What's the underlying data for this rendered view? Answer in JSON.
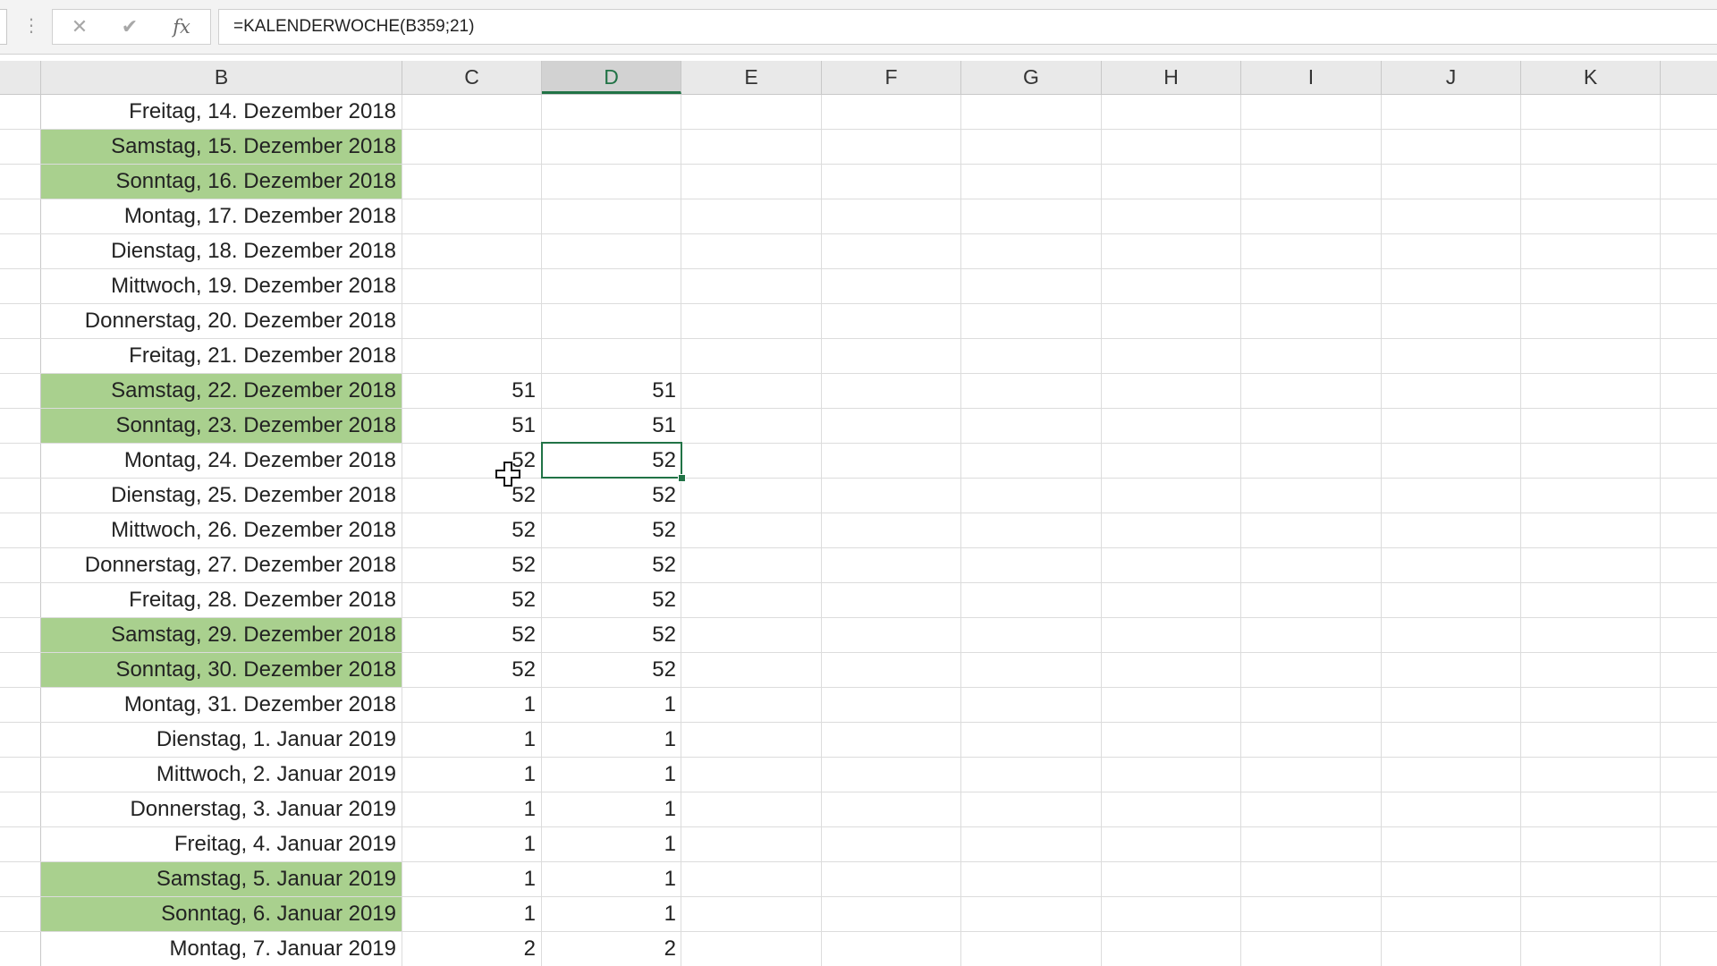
{
  "colors": {
    "weekend_fill": "#a9d08e",
    "selection": "#217346"
  },
  "formula_bar": {
    "menu_icon": "vertical-dots-icon",
    "cancel_icon": "close-icon",
    "cancel_glyph": "✕",
    "enter_icon": "check-icon",
    "enter_glyph": "✔",
    "fx_icon": "function-icon",
    "fx_label": "fx",
    "formula": "=KALENDERWOCHE(B359;21)"
  },
  "columns": [
    {
      "key": "B",
      "label": "B"
    },
    {
      "key": "C",
      "label": "C"
    },
    {
      "key": "D",
      "label": "D",
      "selected": true
    },
    {
      "key": "E",
      "label": "E"
    },
    {
      "key": "F",
      "label": "F"
    },
    {
      "key": "G",
      "label": "G"
    },
    {
      "key": "H",
      "label": "H"
    },
    {
      "key": "I",
      "label": "I"
    },
    {
      "key": "J",
      "label": "J"
    },
    {
      "key": "K",
      "label": "K"
    }
  ],
  "rows": [
    {
      "b": "Freitag, 14. Dezember 2018",
      "c": "",
      "d": "",
      "weekend": false
    },
    {
      "b": "Samstag, 15. Dezember 2018",
      "c": "",
      "d": "",
      "weekend": true
    },
    {
      "b": "Sonntag, 16. Dezember 2018",
      "c": "",
      "d": "",
      "weekend": true
    },
    {
      "b": "Montag, 17. Dezember 2018",
      "c": "",
      "d": "",
      "weekend": false
    },
    {
      "b": "Dienstag, 18. Dezember 2018",
      "c": "",
      "d": "",
      "weekend": false
    },
    {
      "b": "Mittwoch, 19. Dezember 2018",
      "c": "",
      "d": "",
      "weekend": false
    },
    {
      "b": "Donnerstag, 20. Dezember 2018",
      "c": "",
      "d": "",
      "weekend": false
    },
    {
      "b": "Freitag, 21. Dezember 2018",
      "c": "",
      "d": "",
      "weekend": false
    },
    {
      "b": "Samstag, 22. Dezember 2018",
      "c": "51",
      "d": "51",
      "weekend": true
    },
    {
      "b": "Sonntag, 23. Dezember 2018",
      "c": "51",
      "d": "51",
      "weekend": true
    },
    {
      "b": "Montag, 24. Dezember 2018",
      "c": "52",
      "d": "52",
      "weekend": false,
      "active": true
    },
    {
      "b": "Dienstag, 25. Dezember 2018",
      "c": "52",
      "d": "52",
      "weekend": false
    },
    {
      "b": "Mittwoch, 26. Dezember 2018",
      "c": "52",
      "d": "52",
      "weekend": false
    },
    {
      "b": "Donnerstag, 27. Dezember 2018",
      "c": "52",
      "d": "52",
      "weekend": false
    },
    {
      "b": "Freitag, 28. Dezember 2018",
      "c": "52",
      "d": "52",
      "weekend": false
    },
    {
      "b": "Samstag, 29. Dezember 2018",
      "c": "52",
      "d": "52",
      "weekend": true
    },
    {
      "b": "Sonntag, 30. Dezember 2018",
      "c": "52",
      "d": "52",
      "weekend": true
    },
    {
      "b": "Montag, 31. Dezember 2018",
      "c": "1",
      "d": "1",
      "weekend": false
    },
    {
      "b": "Dienstag, 1. Januar 2019",
      "c": "1",
      "d": "1",
      "weekend": false
    },
    {
      "b": "Mittwoch, 2. Januar 2019",
      "c": "1",
      "d": "1",
      "weekend": false
    },
    {
      "b": "Donnerstag, 3. Januar 2019",
      "c": "1",
      "d": "1",
      "weekend": false
    },
    {
      "b": "Freitag, 4. Januar 2019",
      "c": "1",
      "d": "1",
      "weekend": false
    },
    {
      "b": "Samstag, 5. Januar 2019",
      "c": "1",
      "d": "1",
      "weekend": true
    },
    {
      "b": "Sonntag, 6. Januar 2019",
      "c": "1",
      "d": "1",
      "weekend": true
    },
    {
      "b": "Montag, 7. Januar 2019",
      "c": "2",
      "d": "2",
      "weekend": false
    }
  ],
  "cursor_icon": "cell-select-cross-cursor-icon"
}
